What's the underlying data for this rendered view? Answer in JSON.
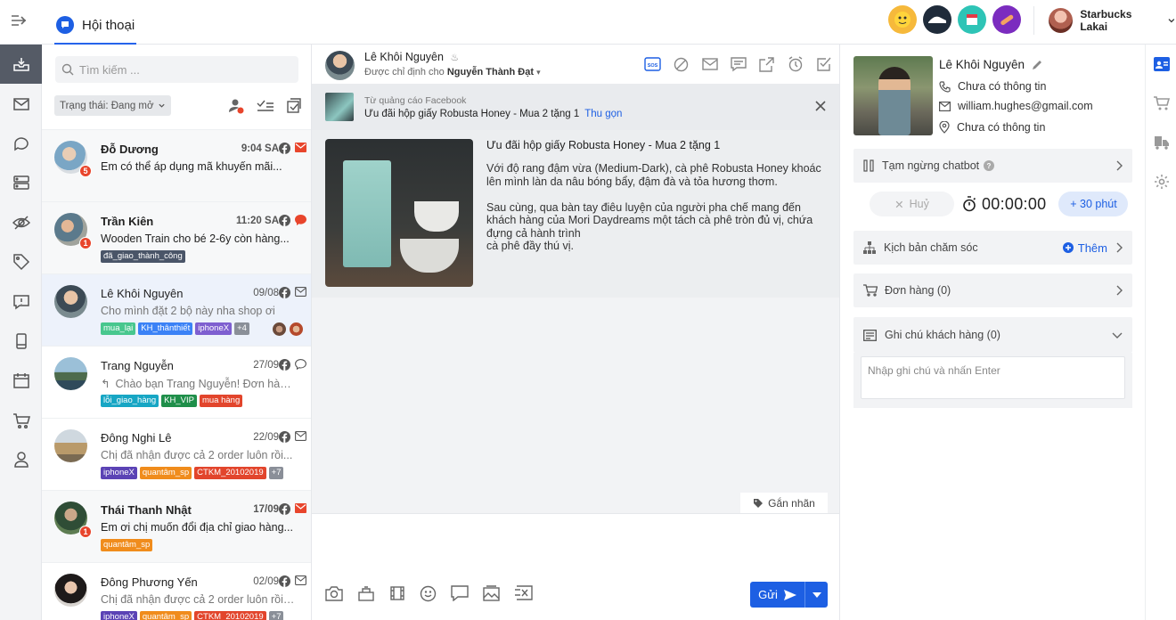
{
  "header": {
    "tab_label": "Hội thoại",
    "user_name": "Starbucks Lakai"
  },
  "conv_list": {
    "search_placeholder": "Tìm kiếm ...",
    "status_filter": "Trạng thái: Đang mở",
    "items": [
      {
        "name": "Đỗ Dương",
        "time": "9:04 SA",
        "message": "Em có thể áp dụng mã khuyến mãi...",
        "badge": "5",
        "tags": []
      },
      {
        "name": "Trần Kiên",
        "time": "11:20 SA",
        "message": "Wooden Train cho bé 2-6y còn hàng...",
        "badge": "1",
        "tags": [
          {
            "label": "đã_giao_thành_công",
            "color": "#4a5568"
          }
        ]
      },
      {
        "name": "Lê Khôi Nguyên",
        "time": "09/08",
        "message": "Cho mình đặt 2 bộ này nha shop ơi",
        "badge": "",
        "tags": [
          {
            "label": "mua_lại",
            "color": "#48c78e"
          },
          {
            "label": "KH_thânthiết",
            "color": "#3b82f6"
          },
          {
            "label": "iphoneX",
            "color": "#7e5fd0"
          },
          {
            "label": "+4",
            "color": "#8a8f98"
          }
        ]
      },
      {
        "name": "Trang Nguyễn",
        "time": "27/09",
        "message": "Chào bạn Trang Nguyễn! Đơn hàng...",
        "badge": "",
        "tags": [
          {
            "label": "lỗi_giao_hàng",
            "color": "#17a6c4"
          },
          {
            "label": "KH_VIP",
            "color": "#1f8f4a"
          },
          {
            "label": "mua hàng",
            "color": "#e2452c"
          }
        ]
      },
      {
        "name": "Đông Nghi Lê",
        "time": "22/09",
        "message": "Chị đã nhận được cả 2 order luôn rồi...",
        "badge": "",
        "tags": [
          {
            "label": "iphoneX",
            "color": "#5b43b5"
          },
          {
            "label": "quantâm_sp",
            "color": "#f08c1c"
          },
          {
            "label": "CTKM_20102019",
            "color": "#e2452c"
          },
          {
            "label": "+7",
            "color": "#8a8f98"
          }
        ]
      },
      {
        "name": "Thái Thanh Nhật",
        "time": "17/09",
        "message": "Em ơi chị muốn đổi địa chỉ giao hàng...",
        "badge": "1",
        "tags": [
          {
            "label": "quantâm_sp",
            "color": "#f08c1c"
          }
        ]
      },
      {
        "name": "Đông Phương Yến",
        "time": "02/09",
        "message": "Chị đã nhận được cả 2 order luôn rồi ...",
        "badge": "",
        "tags": [
          {
            "label": "iphoneX",
            "color": "#5b43b5"
          },
          {
            "label": "quantâm_sp",
            "color": "#f08c1c"
          },
          {
            "label": "CTKM_20102019",
            "color": "#e2452c"
          },
          {
            "label": "+7",
            "color": "#8a8f98"
          }
        ]
      }
    ]
  },
  "chat": {
    "contact_name": "Lê Khôi Nguyên",
    "assigned_prefix": "Được chỉ định cho",
    "assigned_to": "Nguyễn Thành Đạt",
    "ad_source": "Từ quảng cáo Facebook",
    "ad_title": "Ưu đãi hộp giấy Robusta Honey - Mua 2 tặng 1",
    "ad_collapse": "Thu gọn",
    "ad_heading": "Ưu đãi hộp giấy Robusta Honey - Mua 2 tặng 1",
    "ad_body": "Với độ rang đậm vừa (Medium-Dark), cà phê Robusta Honey khoác lên mình làn da nâu bóng bẩy, đậm đà và tỏa hương thơm.\n\nSau cùng, qua bàn tay điêu luyện của người pha chế mang đến khách hàng của Mori Daydreams một tách cà phê tròn đủ vị, chứa đựng cả hành trình\ncà phê đầy thú vị.",
    "label_button": "Gắn nhãn",
    "send_label": "Gửi"
  },
  "profile": {
    "name": "Lê Khôi Nguyên",
    "phone": "Chưa có thông tin",
    "email": "william.hughes@gmail.com",
    "address": "Chưa có thông tin",
    "chatbot_pause": "Tạm ngừng chatbot",
    "cancel_label": "Huỷ",
    "timer": "00:00:00",
    "add_time": "+ 30 phút",
    "care_script": "Kịch bản chăm sóc",
    "add_label": "Thêm",
    "orders": "Đơn hàng (0)",
    "notes": "Ghi chú khách hàng (0)",
    "note_placeholder": "Nhập ghi chú và nhấn Enter"
  },
  "colors": {
    "accent": "#1d5fe3",
    "facebook": "#555",
    "email_orange": "#e8452c"
  }
}
